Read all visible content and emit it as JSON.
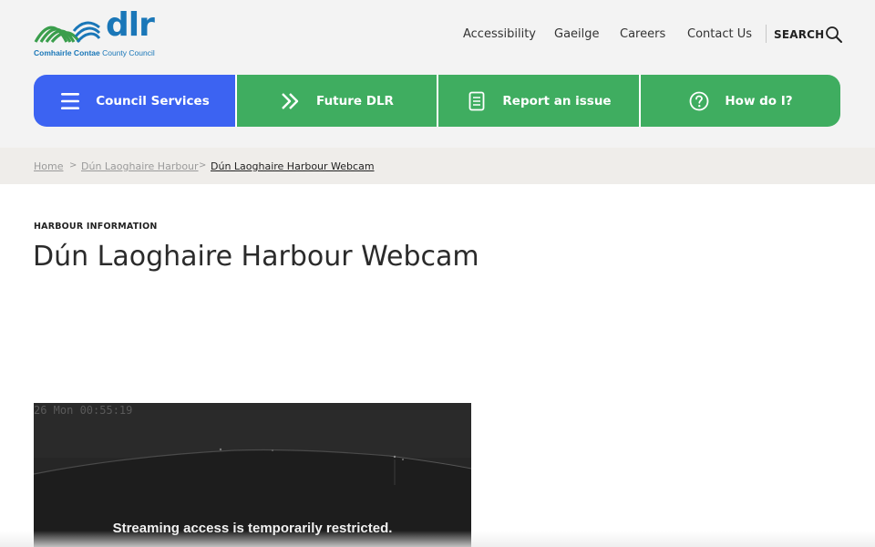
{
  "logo": {
    "text": "dlr",
    "sub_bold": "Comhairle Contae",
    "sub_regular": " County Council"
  },
  "top_links": [
    "Accessibility",
    "Gaeilge",
    "Careers",
    "Contact Us"
  ],
  "search_label": "SEARCH",
  "nav": [
    {
      "label": "Council Services",
      "icon": "menu-icon"
    },
    {
      "label": "Future DLR",
      "icon": "double-chevron-right-icon"
    },
    {
      "label": "Report an issue",
      "icon": "clipboard-icon"
    },
    {
      "label": "How do I?",
      "icon": "question-circle-icon"
    }
  ],
  "breadcrumb": {
    "items": [
      "Home",
      "Dún Laoghaire Harbour",
      "Dún Laoghaire Harbour Webcam"
    ],
    "separator": ">"
  },
  "main": {
    "eyebrow": "HARBOUR INFORMATION",
    "title": "Dún Laoghaire Harbour Webcam"
  },
  "webcam": {
    "timestamp": "26 Mon 00:55:19",
    "message": "Streaming access is temporarily restricted."
  },
  "colors": {
    "nav_blue": "#3c63f2",
    "nav_green": "#3fad60",
    "logo_blue": "#1a77b8",
    "logo_green": "#3a9e4c"
  }
}
